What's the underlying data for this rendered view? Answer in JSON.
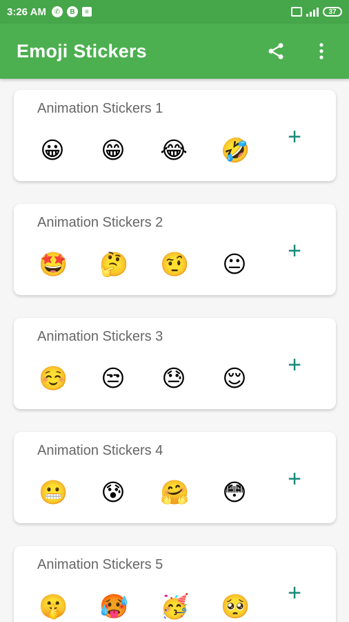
{
  "status_bar": {
    "time": "3:26 AM",
    "icons": [
      "phone-icon",
      "b-icon",
      "notification-icon"
    ],
    "battery": "37"
  },
  "app_bar": {
    "title": "Emoji Stickers",
    "actions": [
      "share-icon",
      "more-vert-icon"
    ]
  },
  "packs": [
    {
      "title": "Animation Stickers 1",
      "emojis": [
        "😀",
        "😁",
        "😂",
        "🤣"
      ],
      "add_label": "+"
    },
    {
      "title": "Animation Stickers 2",
      "emojis": [
        "🤩",
        "🤔",
        "🤨",
        "😐"
      ],
      "add_label": "+"
    },
    {
      "title": "Animation Stickers 3",
      "emojis": [
        "☺️",
        "😒",
        "😓",
        "😌"
      ],
      "add_label": "+"
    },
    {
      "title": "Animation Stickers 4",
      "emojis": [
        "😬",
        "😰",
        "🤗",
        "😳"
      ],
      "add_label": "+"
    },
    {
      "title": "Animation Stickers 5",
      "emojis": [
        "🤫",
        "🥵",
        "🥳",
        "🥺"
      ],
      "add_label": "+"
    }
  ],
  "colors": {
    "status_bar": "#46a64a",
    "app_bar": "#4caf50",
    "accent": "#1a8a7a"
  }
}
